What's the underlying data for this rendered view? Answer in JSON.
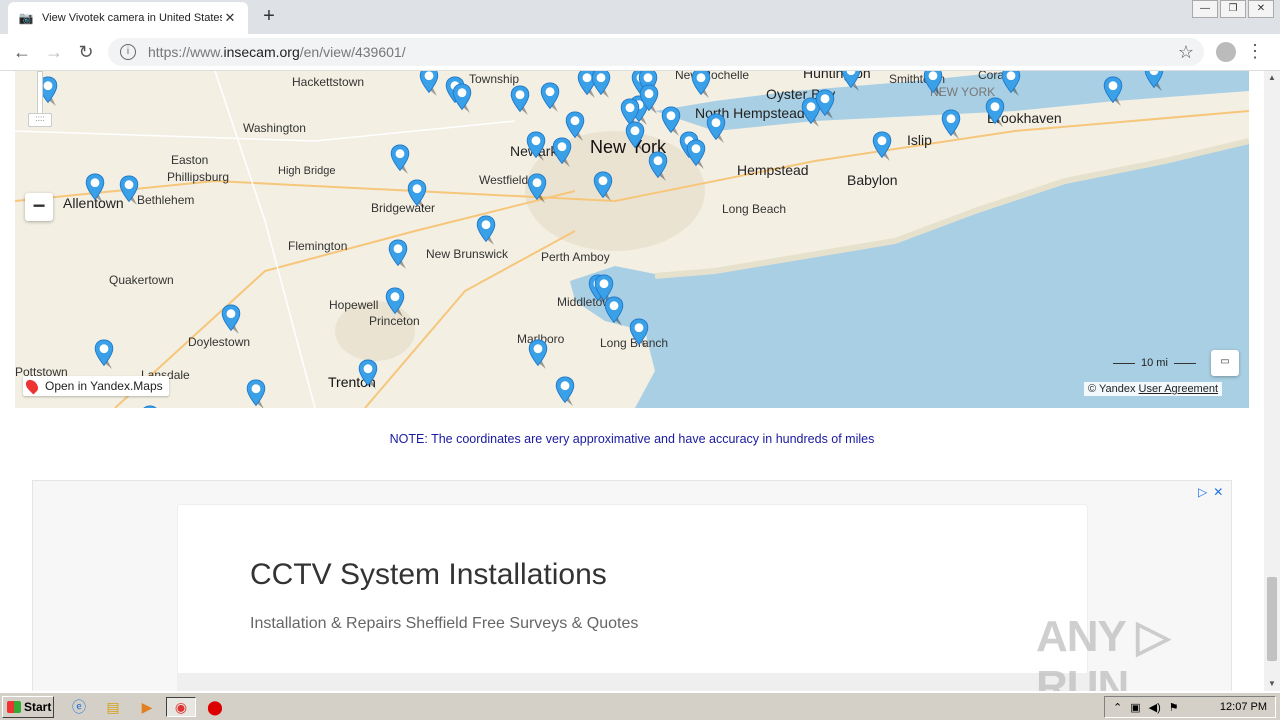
{
  "browser": {
    "tab_title": "View Vivotek camera in United States",
    "tab_close": "✕",
    "new_tab": "+",
    "url_prefix": "https://www.",
    "url_domain": "insecam.org",
    "url_path": "/en/view/439601/",
    "window_controls": [
      "—",
      "❐",
      "✕"
    ],
    "back": "←",
    "forward": "→",
    "reload": "↻",
    "star": "☆",
    "menu": "⋮"
  },
  "map": {
    "labels": {
      "hackettstown": "Hackettstown",
      "washington": "Washington",
      "easton": "Easton",
      "phillipsburg": "Phillipsburg",
      "high_bridge": "High Bridge",
      "allentown": "Allentown",
      "bethlehem": "Bethlehem",
      "flemington": "Flemington",
      "quakertown": "Quakertown",
      "doylestown": "Doylestown",
      "pottstown": "Pottstown",
      "lansdale": "Lansdale",
      "hopewell": "Hopewell",
      "princeton": "Princeton",
      "trenton": "Trenton",
      "new_brunswick": "New Brunswick",
      "bridgewater": "Bridgewater",
      "westfield": "Westfield",
      "newark": "Newark",
      "new_york": "New York",
      "township": "Township",
      "new_rochelle": "New Rochelle",
      "north_hempstead": "North Hempstead",
      "hempstead": "Hempstead",
      "long_beach": "Long Beach",
      "oyster_bay": "Oyster Bay",
      "huntington": "Huntington",
      "smithtown": "Smithtown",
      "babylon": "Babylon",
      "islip": "Islip",
      "brookhaven": "Brookhaven",
      "coram": "Coram",
      "ny_state": "NEW YORK",
      "perth_amboy": "Perth Amboy",
      "middletown": "Middletown",
      "long_branch": "Long Branch",
      "marlboro": "Marlboro"
    },
    "open_link": "Open in Yandex.Maps",
    "zoom_out": "−",
    "scale": "10 mi",
    "copyright_prefix": "© Yandex",
    "user_agreement": "User Agreement",
    "pin_color": "#3aa0e8"
  },
  "note": "NOTE: The coordinates are very approximative and have accuracy in hundreds of miles",
  "ad": {
    "title": "CCTV System Installations",
    "subtitle": "Installation & Repairs Sheffield Free Surveys & Quotes",
    "choices": [
      "▷",
      "✕"
    ]
  },
  "watermark": "ANY ▷ RUN",
  "taskbar": {
    "start": "Start",
    "clock": "12:07 PM"
  }
}
